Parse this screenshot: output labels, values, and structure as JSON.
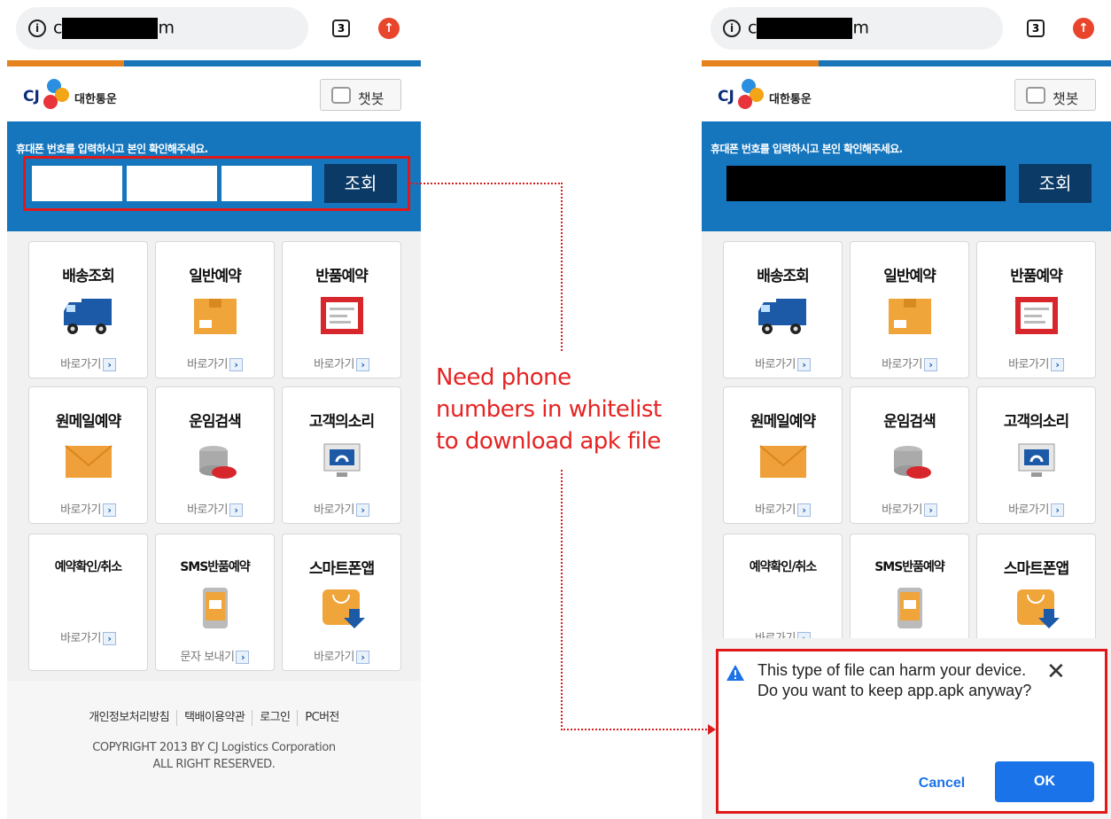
{
  "browser": {
    "url_start": "c",
    "url_end": "m",
    "tab_count": "3",
    "update_icon": "arrow-up-circle-icon",
    "info_icon": "info-circle-icon"
  },
  "site": {
    "logo_cj": "CJ",
    "logo_name": "대한통운",
    "chatbot_label": "챗봇",
    "search_prompt": "휴대폰 번호를 입력하시고 본인 확인해주세요.",
    "search_button": "조회"
  },
  "menu": [
    {
      "title": "배송조회",
      "link": "바로가기",
      "icon": "truck-icon"
    },
    {
      "title": "일반예약",
      "link": "바로가기",
      "icon": "parcel-box-icon"
    },
    {
      "title": "반품예약",
      "link": "바로가기",
      "icon": "return-slip-icon"
    },
    {
      "title": "원메일예약",
      "link": "바로가기",
      "icon": "envelope-icon"
    },
    {
      "title": "운임검색",
      "link": "바로가기",
      "icon": "coins-icon"
    },
    {
      "title": "고객의소리",
      "link": "바로가기",
      "icon": "monitor-headset-icon"
    },
    {
      "title": "예약확인/취소",
      "link": "바로가기",
      "icon": ""
    },
    {
      "title": "SMS반품예약",
      "link": "문자 보내기",
      "icon": "mobile-message-icon"
    },
    {
      "title": "스마트폰앱",
      "link": "바로가기",
      "icon": "app-download-icon"
    }
  ],
  "footer": {
    "links": [
      "개인정보처리방침",
      "택배이용약관",
      "로그인",
      "PC버전"
    ],
    "copyright_line1": "COPYRIGHT 2013 BY CJ Logistics Corporation",
    "copyright_line2": "ALL RIGHT RESERVED."
  },
  "annotation": {
    "line1": "Need phone",
    "line2": "numbers in whitelist",
    "line3": "to download apk file"
  },
  "dialog": {
    "message": "This type of file can harm your device. Do you want to keep app.apk anyway?",
    "cancel_label": "Cancel",
    "ok_label": "OK",
    "warning_icon": "warning-triangle-icon",
    "close_icon": "close-icon"
  },
  "colors": {
    "annotation_red": "#e01818",
    "site_blue": "#1576be",
    "dialog_button_blue": "#1a73e8",
    "progress_orange": "#e6821e"
  }
}
